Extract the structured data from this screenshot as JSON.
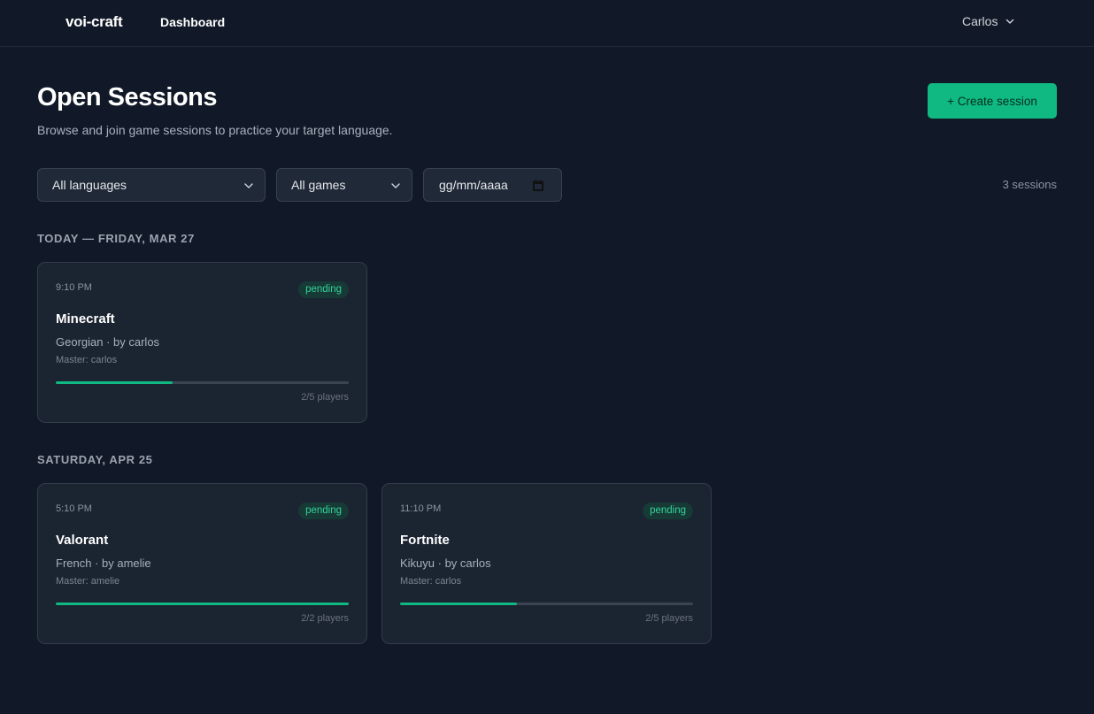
{
  "header": {
    "brand": "voi-craft",
    "nav_dashboard": "Dashboard",
    "user_name": "Carlos"
  },
  "page": {
    "title": "Open Sessions",
    "subtitle": "Browse and join game sessions to practice your target language.",
    "create_button": "+ Create session"
  },
  "filters": {
    "language": "All languages",
    "games": "All games",
    "date": "gg/mm/aaaa",
    "session_count": "3 sessions"
  },
  "groups": [
    {
      "heading": "TODAY — FRIDAY, MAR 27",
      "sessions": [
        {
          "time": "9:10 PM",
          "status": "pending",
          "game": "Minecraft",
          "language_by": "Georgian · by carlos",
          "master": "Master: carlos",
          "players": "2/5 players",
          "fill_fraction": 0.4
        }
      ]
    },
    {
      "heading": "SATURDAY, APR 25",
      "sessions": [
        {
          "time": "5:10 PM",
          "status": "pending",
          "game": "Valorant",
          "language_by": "French · by amelie",
          "master": "Master: amelie",
          "players": "2/2 players",
          "fill_fraction": 1.0
        },
        {
          "time": "11:10 PM",
          "status": "pending",
          "game": "Fortnite",
          "language_by": "Kikuyu · by carlos",
          "master": "Master: carlos",
          "players": "2/5 players",
          "fill_fraction": 0.4
        }
      ]
    }
  ],
  "colors": {
    "background": "#111827",
    "accent": "#10b981",
    "badge_text": "#34d399",
    "card": "#1b2431"
  }
}
